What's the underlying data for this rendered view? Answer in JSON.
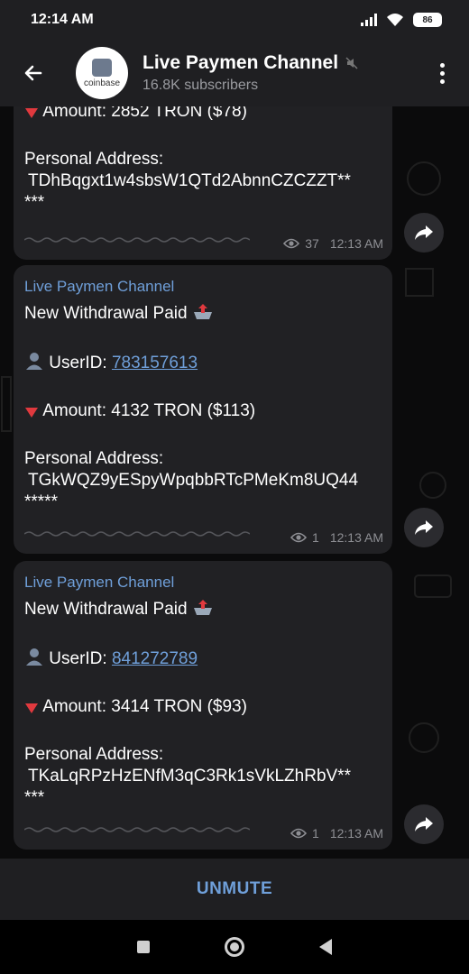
{
  "status": {
    "time": "12:14 AM",
    "battery": "86"
  },
  "header": {
    "title": "Live Paymen Channel",
    "subscribers": "16.8K subscribers",
    "avatar_text": "coinbase"
  },
  "messages": [
    {
      "amount_partial": "Amount: 2852 TRON ($78)",
      "address_label": "Personal Address:",
      "address_line1": "TDhBqgxt1w4sbsW1QTd2AbnnCZCZZT**",
      "address_line2": "***",
      "views": "37",
      "time": "12:13 AM"
    },
    {
      "channel": "Live Paymen Channel",
      "title": "New Withdrawal Paid",
      "userid_label": "UserID:",
      "userid": "783157613",
      "amount": "Amount: 4132 TRON ($113)",
      "address_label": "Personal Address:",
      "address_line1": "TGkWQZ9yESpyWpqbbRTcPMeKm8UQ44",
      "address_line2": "*****",
      "views": "1",
      "time": "12:13 AM"
    },
    {
      "channel": "Live Paymen Channel",
      "title": "New Withdrawal Paid",
      "userid_label": "UserID:",
      "userid": "841272789",
      "amount": "Amount: 3414 TRON ($93)",
      "address_label": "Personal Address:",
      "address_line1": "TKaLqRPzHzENfM3qC3Rk1sVkLZhRbV**",
      "address_line2": "***",
      "views": "1",
      "time": "12:13 AM"
    }
  ],
  "bottom": {
    "unmute_label": "UNMUTE"
  },
  "colors": {
    "accent": "#6f9fd9",
    "bubble": "#212124",
    "header": "#1f1f22"
  }
}
